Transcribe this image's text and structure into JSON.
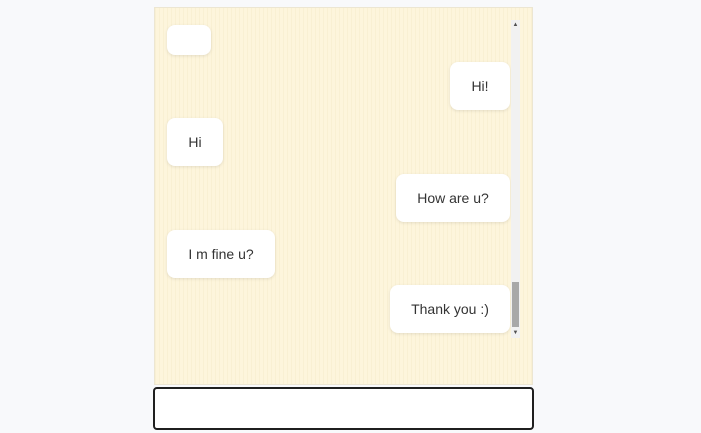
{
  "chat": {
    "messages": [
      {
        "sender": "other",
        "text": ""
      },
      {
        "sender": "me",
        "text": "Hi!"
      },
      {
        "sender": "other",
        "text": "Hi"
      },
      {
        "sender": "me",
        "text": "How are u?"
      },
      {
        "sender": "other",
        "text": "I m fine u?"
      },
      {
        "sender": "me",
        "text": "Thank you :)"
      }
    ]
  },
  "scrollbar": {
    "up_icon": "triangle-up",
    "down_icon": "triangle-down"
  },
  "composer": {
    "value": "",
    "placeholder": ""
  },
  "colors": {
    "chat_background": "#fdf5dc",
    "bubble": "#ffffff",
    "input_border": "#1f1f1f"
  }
}
